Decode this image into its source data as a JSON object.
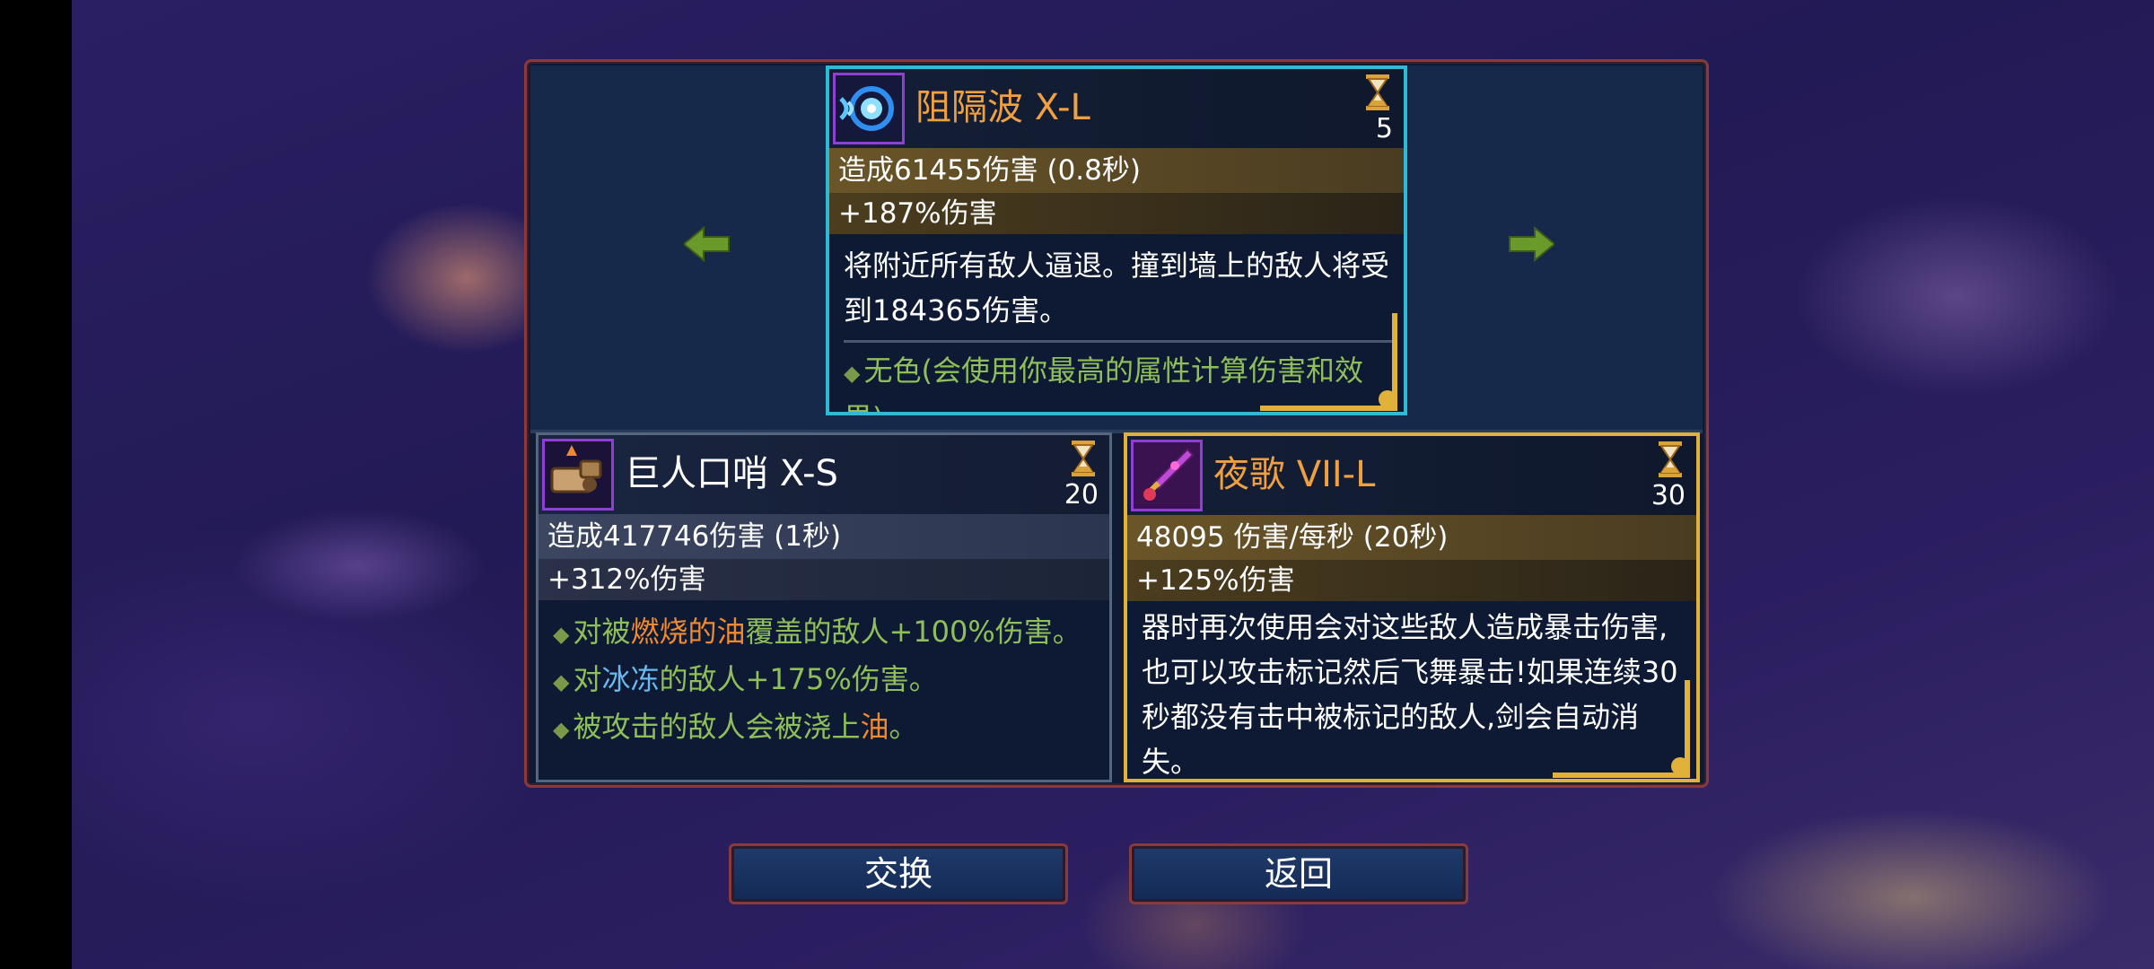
{
  "cards": {
    "top": {
      "title": "阻隔波 X-L",
      "title_color": "#f0a040",
      "icon": "wave-blast-icon",
      "cooldown": "5",
      "stat_damage": "造成61455伤害 (0.8秒)",
      "stat_bonus": "+187%伤害",
      "description": "将附近所有敌人逼退。撞到墙上的敌人将受到184365伤害。",
      "effect": "无色(会使用你最高的属性计算伤害和效果)",
      "border_color": "#2fb9d4"
    },
    "left": {
      "title": "巨人口哨 X-S",
      "title_color": "#ffffff",
      "icon": "giant-whistle-icon",
      "cooldown": "20",
      "stat_damage": "造成417746伤害 (1秒)",
      "stat_bonus": "+312%伤害",
      "effects": [
        {
          "prefix": "对被",
          "fire": "燃烧的油",
          "suffix": "覆盖的敌人+100%伤害。"
        },
        {
          "prefix": "对",
          "ice": "冰冻",
          "suffix": "的敌人+175%伤害。"
        },
        {
          "prefix": "被攻击的敌人会被浇上",
          "fire": "油",
          "suffix": "。"
        }
      ]
    },
    "right": {
      "title": "夜歌 VII-L",
      "title_color": "#f0a040",
      "icon": "nightsong-sword-icon",
      "cooldown": "30",
      "stat_damage": "48095 伤害/每秒 (20秒)",
      "stat_bonus": "+125%伤害",
      "description": "器时再次使用会对这些敌人造成暴击伤害,也可以攻击标记然后飞舞暴击!如果连续30秒都没有击中被标记的敌人,剑会自动消失。",
      "border_color": "#e0b23a"
    }
  },
  "buttons": {
    "swap": "交换",
    "back": "返回"
  },
  "colors": {
    "panel_border": "#8a3a3a",
    "arrow_green": "#6a9a2a"
  }
}
